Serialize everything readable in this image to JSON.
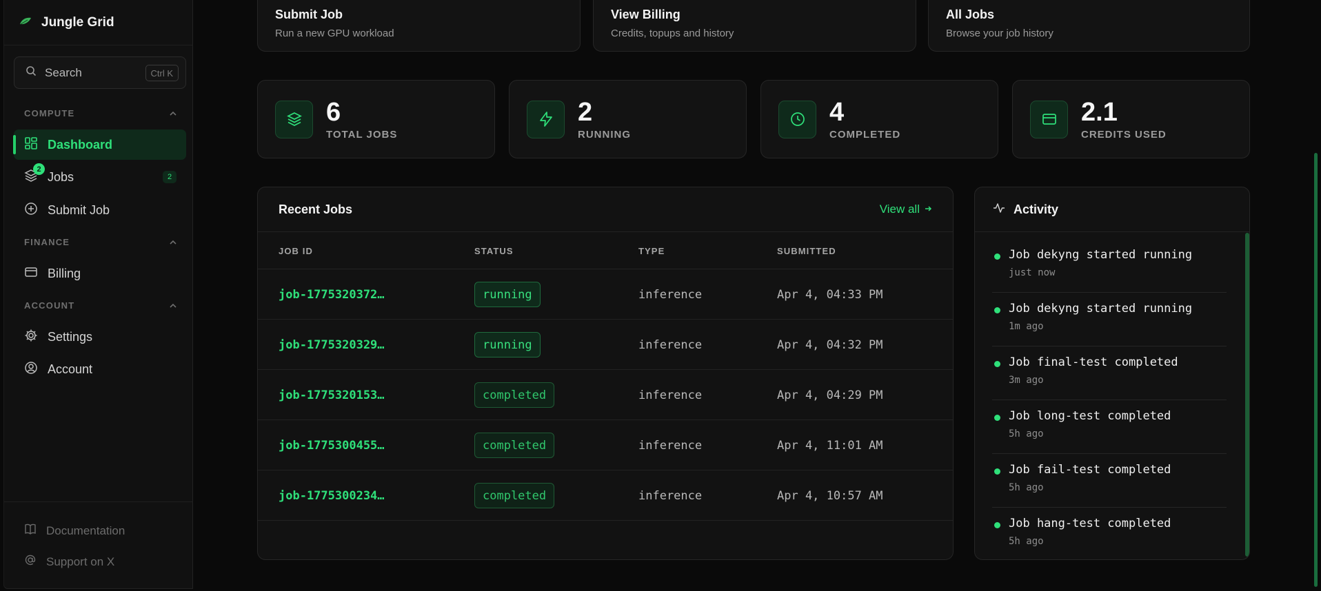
{
  "app": {
    "name": "Jungle Grid"
  },
  "search": {
    "label": "Search",
    "shortcut": "Ctrl K"
  },
  "sidebar": {
    "sections": [
      {
        "title": "COMPUTE"
      },
      {
        "title": "FINANCE"
      },
      {
        "title": "ACCOUNT"
      }
    ],
    "items": [
      {
        "label": "Dashboard",
        "icon": "dashboard-icon",
        "active": true
      },
      {
        "label": "Jobs",
        "icon": "layers-icon",
        "count": "2",
        "badge": "2"
      },
      {
        "label": "Submit Job",
        "icon": "plus-circle-icon"
      },
      {
        "label": "Billing",
        "icon": "credit-card-icon"
      },
      {
        "label": "Settings",
        "icon": "gear-icon"
      },
      {
        "label": "Account",
        "icon": "user-circle-icon"
      }
    ],
    "footer": [
      {
        "label": "Documentation",
        "icon": "book-icon"
      },
      {
        "label": "Support on X",
        "icon": "at-icon"
      }
    ]
  },
  "quick_actions": [
    {
      "title": "Submit Job",
      "subtitle": "Run a new GPU workload"
    },
    {
      "title": "View Billing",
      "subtitle": "Credits, topups and history"
    },
    {
      "title": "All Jobs",
      "subtitle": "Browse your job history"
    }
  ],
  "stats": [
    {
      "value": "6",
      "label": "TOTAL JOBS",
      "icon": "layers-icon"
    },
    {
      "value": "2",
      "label": "RUNNING",
      "icon": "bolt-icon"
    },
    {
      "value": "4",
      "label": "COMPLETED",
      "icon": "clock-icon"
    },
    {
      "value": "2.1",
      "label": "CREDITS USED",
      "icon": "card-icon"
    }
  ],
  "recent_jobs": {
    "title": "Recent Jobs",
    "view_all": "View all",
    "columns": [
      "JOB ID",
      "STATUS",
      "TYPE",
      "SUBMITTED"
    ],
    "rows": [
      {
        "id": "job-1775320372…",
        "status": "running",
        "type": "inference",
        "submitted": "Apr 4, 04:33 PM"
      },
      {
        "id": "job-1775320329…",
        "status": "running",
        "type": "inference",
        "submitted": "Apr 4, 04:32 PM"
      },
      {
        "id": "job-1775320153…",
        "status": "completed",
        "type": "inference",
        "submitted": "Apr 4, 04:29 PM"
      },
      {
        "id": "job-1775300455…",
        "status": "completed",
        "type": "inference",
        "submitted": "Apr 4, 11:01 AM"
      },
      {
        "id": "job-1775300234…",
        "status": "completed",
        "type": "inference",
        "submitted": "Apr 4, 10:57 AM"
      }
    ]
  },
  "activity": {
    "title": "Activity",
    "items": [
      {
        "text": "Job dekyng started running",
        "time": "just now"
      },
      {
        "text": "Job dekyng started running",
        "time": "1m ago"
      },
      {
        "text": "Job final-test completed",
        "time": "3m ago"
      },
      {
        "text": "Job long-test completed",
        "time": "5h ago"
      },
      {
        "text": "Job fail-test completed",
        "time": "5h ago"
      },
      {
        "text": "Job hang-test completed",
        "time": "5h ago"
      }
    ]
  },
  "colors": {
    "accent": "#2fe07a",
    "background": "#0a0a0a",
    "panel": "#131313"
  }
}
